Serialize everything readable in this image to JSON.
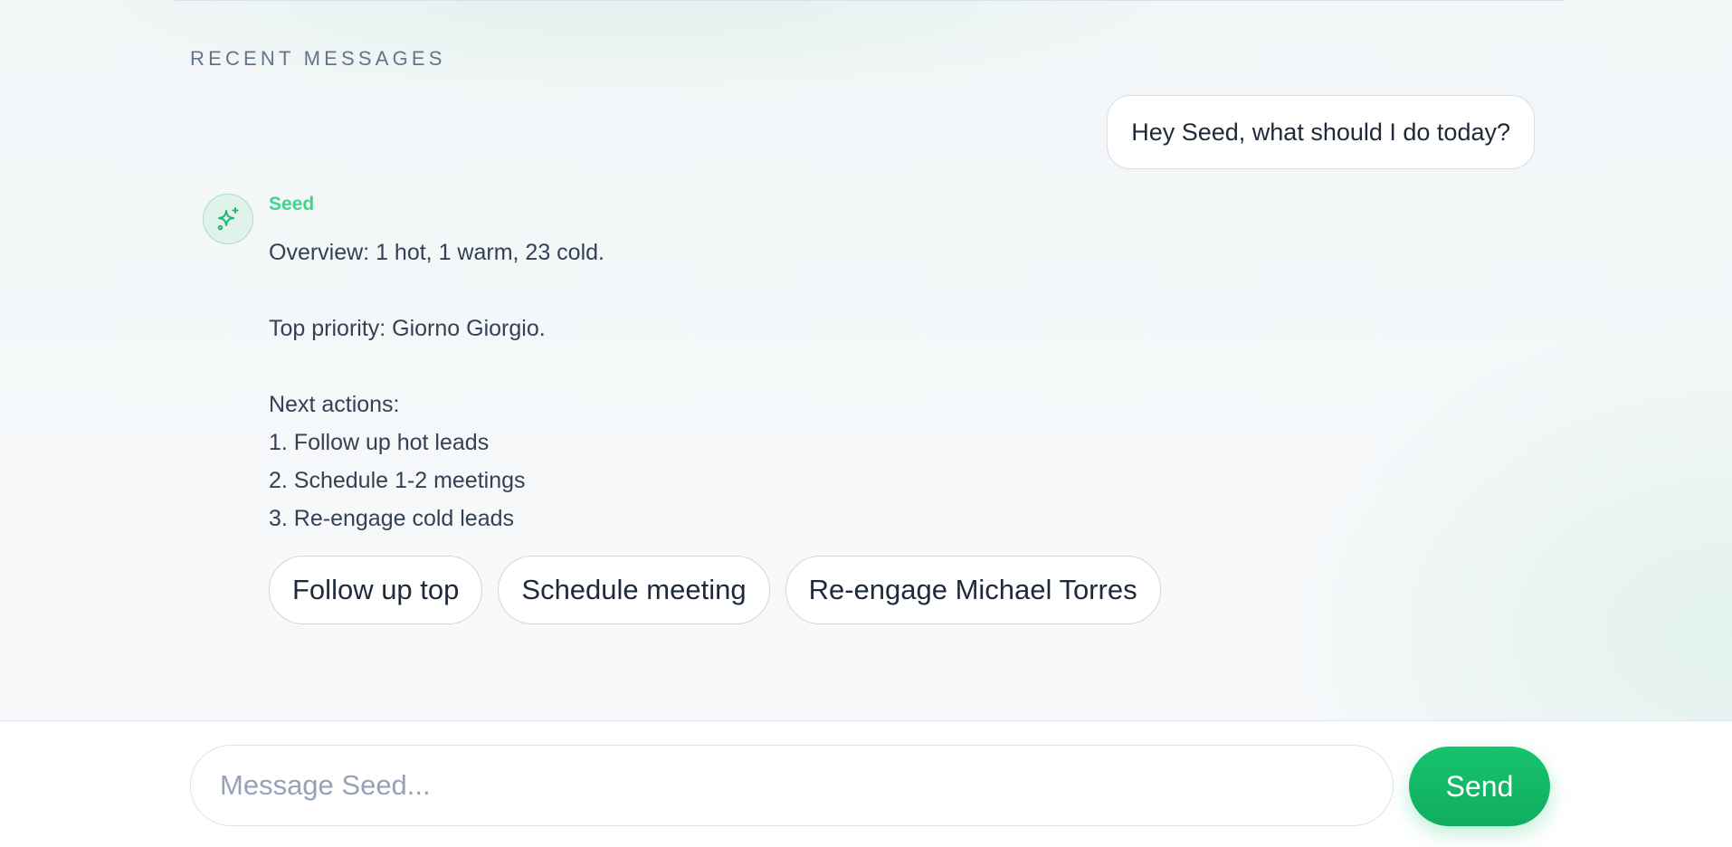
{
  "recent": {
    "section_label": "RECENT MESSAGES"
  },
  "messages": {
    "user_message": "Hey Seed, what should I do today?",
    "assistant": {
      "name": "Seed",
      "avatar_icon": "sparkle-icon",
      "lines": [
        "Overview: 1 hot, 1 warm, 23 cold.",
        "Top priority: Giorno Giorgio.",
        "Next actions:",
        "1. Follow up hot leads",
        "2. Schedule 1-2 meetings",
        "3. Re-engage cold leads"
      ]
    },
    "quick_actions": [
      "Follow up top",
      "Schedule meeting",
      "Re-engage Michael Torres"
    ]
  },
  "composer": {
    "placeholder": "Message Seed...",
    "value": "",
    "send_label": "Send"
  },
  "colors": {
    "accent": "#16c36f",
    "assistant_name": "#3dd68c"
  }
}
